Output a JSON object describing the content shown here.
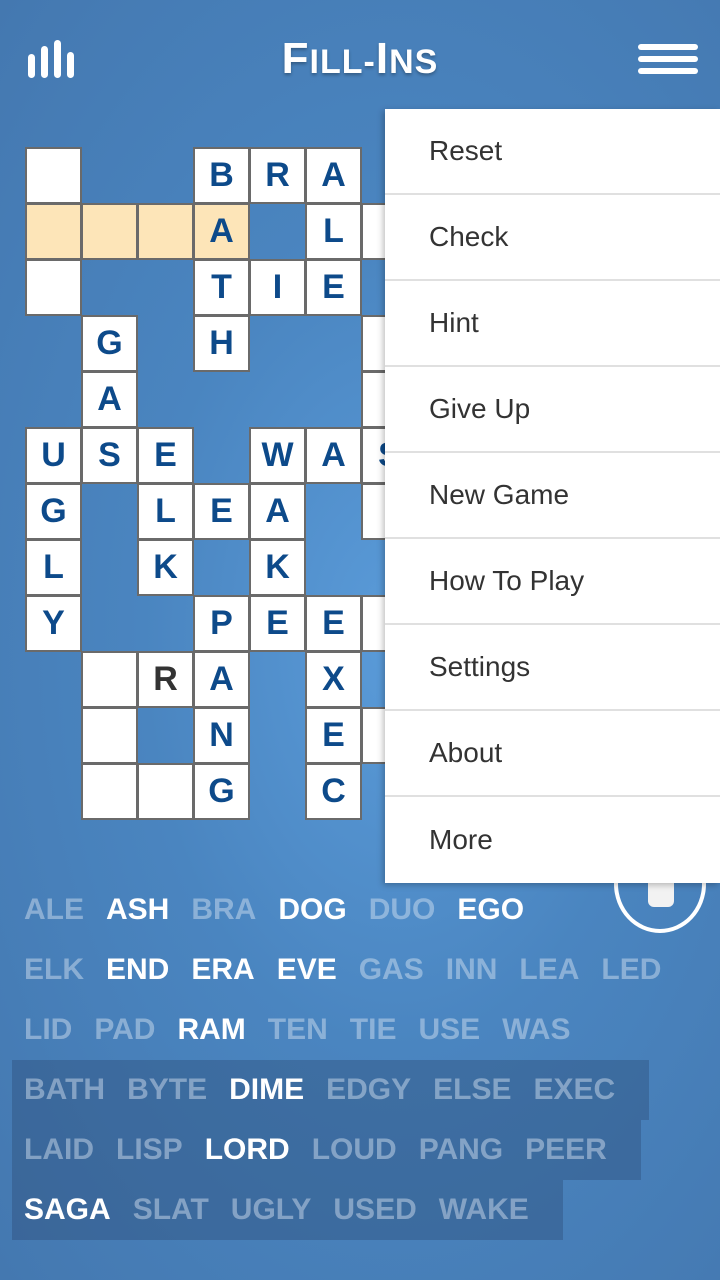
{
  "header": {
    "title_big1": "F",
    "title_small1": "ILL-",
    "title_big2": "I",
    "title_small2": "NS",
    "stats_icon": "bar-chart-icon",
    "menu_icon": "hamburger-icon"
  },
  "grid": [
    {
      "r": 0,
      "c": 0,
      "l": ""
    },
    {
      "r": 0,
      "c": 3,
      "l": "B"
    },
    {
      "r": 0,
      "c": 4,
      "l": "R"
    },
    {
      "r": 0,
      "c": 5,
      "l": "A"
    },
    {
      "r": 1,
      "c": 0,
      "l": "",
      "hl": true
    },
    {
      "r": 1,
      "c": 1,
      "l": "",
      "hl": true
    },
    {
      "r": 1,
      "c": 2,
      "l": "",
      "hl": true
    },
    {
      "r": 1,
      "c": 3,
      "l": "A",
      "hl": true
    },
    {
      "r": 1,
      "c": 5,
      "l": "L"
    },
    {
      "r": 1,
      "c": 6,
      "l": ""
    },
    {
      "r": 2,
      "c": 0,
      "l": ""
    },
    {
      "r": 2,
      "c": 3,
      "l": "T"
    },
    {
      "r": 2,
      "c": 4,
      "l": "I"
    },
    {
      "r": 2,
      "c": 5,
      "l": "E"
    },
    {
      "r": 3,
      "c": 1,
      "l": "G"
    },
    {
      "r": 3,
      "c": 3,
      "l": "H"
    },
    {
      "r": 3,
      "c": 6,
      "l": ""
    },
    {
      "r": 4,
      "c": 1,
      "l": "A"
    },
    {
      "r": 4,
      "c": 6,
      "l": ""
    },
    {
      "r": 5,
      "c": 0,
      "l": "U"
    },
    {
      "r": 5,
      "c": 1,
      "l": "S"
    },
    {
      "r": 5,
      "c": 2,
      "l": "E"
    },
    {
      "r": 5,
      "c": 4,
      "l": "W"
    },
    {
      "r": 5,
      "c": 5,
      "l": "A"
    },
    {
      "r": 5,
      "c": 6,
      "l": "S"
    },
    {
      "r": 6,
      "c": 0,
      "l": "G"
    },
    {
      "r": 6,
      "c": 2,
      "l": "L"
    },
    {
      "r": 6,
      "c": 3,
      "l": "E"
    },
    {
      "r": 6,
      "c": 4,
      "l": "A"
    },
    {
      "r": 6,
      "c": 6,
      "l": ""
    },
    {
      "r": 7,
      "c": 0,
      "l": "L"
    },
    {
      "r": 7,
      "c": 2,
      "l": "K"
    },
    {
      "r": 7,
      "c": 4,
      "l": "K"
    },
    {
      "r": 8,
      "c": 0,
      "l": "Y"
    },
    {
      "r": 8,
      "c": 3,
      "l": "P"
    },
    {
      "r": 8,
      "c": 4,
      "l": "E"
    },
    {
      "r": 8,
      "c": 5,
      "l": "E"
    },
    {
      "r": 8,
      "c": 6,
      "l": ""
    },
    {
      "r": 9,
      "c": 1,
      "l": ""
    },
    {
      "r": 9,
      "c": 2,
      "l": "R",
      "user": true
    },
    {
      "r": 9,
      "c": 3,
      "l": "A"
    },
    {
      "r": 9,
      "c": 5,
      "l": "X"
    },
    {
      "r": 10,
      "c": 1,
      "l": ""
    },
    {
      "r": 10,
      "c": 3,
      "l": "N"
    },
    {
      "r": 10,
      "c": 5,
      "l": "E"
    },
    {
      "r": 10,
      "c": 6,
      "l": ""
    },
    {
      "r": 11,
      "c": 1,
      "l": ""
    },
    {
      "r": 11,
      "c": 2,
      "l": ""
    },
    {
      "r": 11,
      "c": 3,
      "l": "G"
    },
    {
      "r": 11,
      "c": 5,
      "l": "C"
    }
  ],
  "menu": [
    "Reset",
    "Check",
    "Hint",
    "Give Up",
    "New Game",
    "How To Play",
    "Settings",
    "About",
    "More"
  ],
  "trash_icon": "trash-icon",
  "word_bank": [
    {
      "dark": false,
      "words": [
        [
          "ALE",
          0
        ],
        [
          "ASH",
          1
        ],
        [
          "BRA",
          0
        ],
        [
          "DOG",
          1
        ],
        [
          "DUO",
          0
        ],
        [
          "EGO",
          1
        ]
      ]
    },
    {
      "dark": false,
      "words": [
        [
          "ELK",
          0
        ],
        [
          "END",
          1
        ],
        [
          "ERA",
          1
        ],
        [
          "EVE",
          1
        ],
        [
          "GAS",
          0
        ],
        [
          "INN",
          0
        ],
        [
          "LEA",
          0
        ],
        [
          "LED",
          0
        ]
      ]
    },
    {
      "dark": false,
      "words": [
        [
          "LID",
          0
        ],
        [
          "PAD",
          0
        ],
        [
          "RAM",
          1
        ],
        [
          "TEN",
          0
        ],
        [
          "TIE",
          0
        ],
        [
          "USE",
          0
        ],
        [
          "WAS",
          0
        ]
      ]
    },
    {
      "dark": true,
      "words": [
        [
          "BATH",
          0
        ],
        [
          "BYTE",
          0
        ],
        [
          "DIME",
          1
        ],
        [
          "EDGY",
          0
        ],
        [
          "ELSE",
          0
        ],
        [
          "EXEC",
          0
        ]
      ]
    },
    {
      "dark": true,
      "words": [
        [
          "LAID",
          0
        ],
        [
          "LISP",
          0
        ],
        [
          "LORD",
          1
        ],
        [
          "LOUD",
          0
        ],
        [
          "PANG",
          0
        ],
        [
          "PEER",
          0
        ]
      ]
    },
    {
      "dark": true,
      "words": [
        [
          "SAGA",
          1
        ],
        [
          "SLAT",
          0
        ],
        [
          "UGLY",
          0
        ],
        [
          "USED",
          0
        ],
        [
          "WAKE",
          0
        ]
      ]
    }
  ]
}
